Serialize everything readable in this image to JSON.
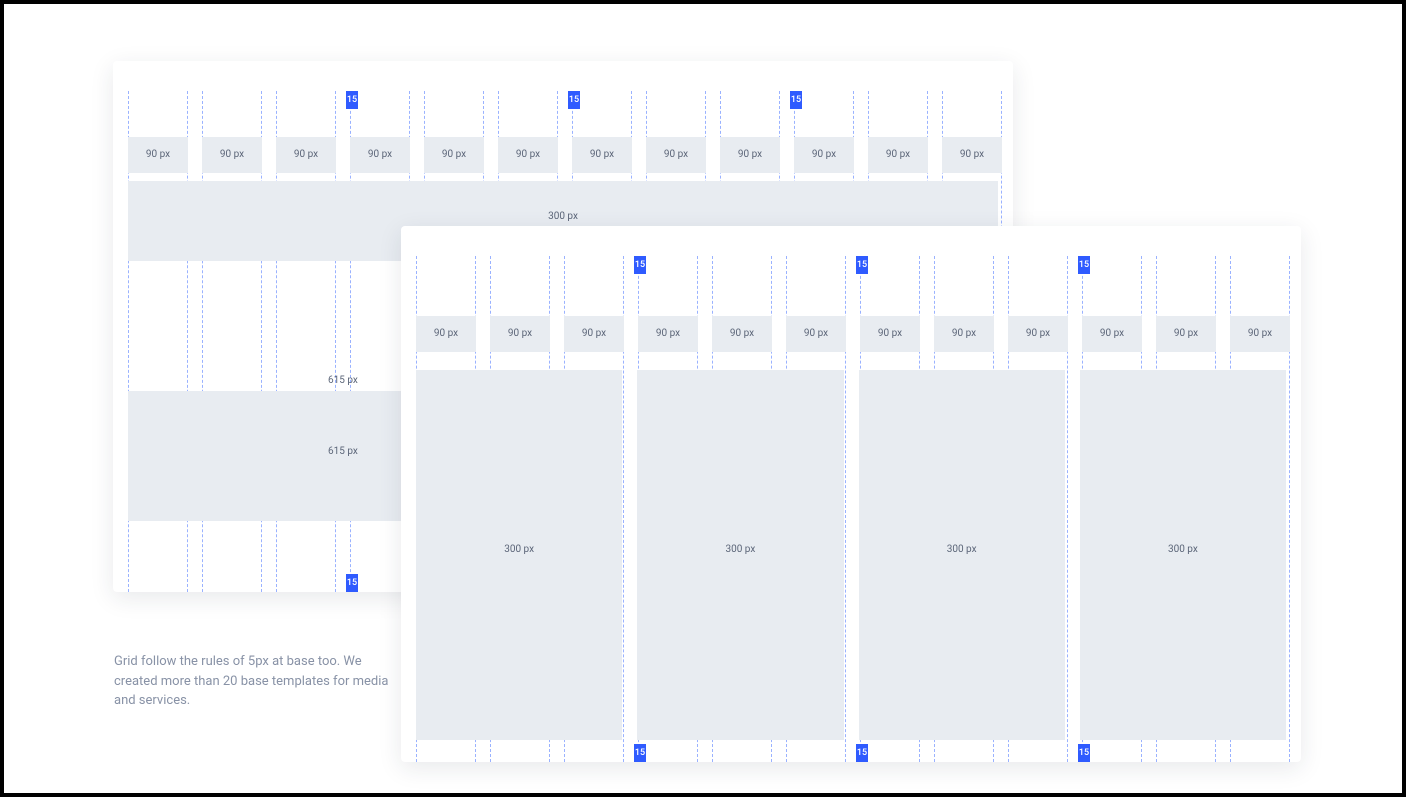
{
  "caption": "Grid follow the rules of 5px at base too. We created more than 20 base templates for media and services.",
  "gutter_label": "15",
  "col_label": "90 px",
  "panel_a": {
    "wide_row_1_label": "300 px",
    "wide_row_2_label": "615 px",
    "wide_row_3_label": "615 px"
  },
  "panel_b": {
    "quad_label": "300 px"
  }
}
